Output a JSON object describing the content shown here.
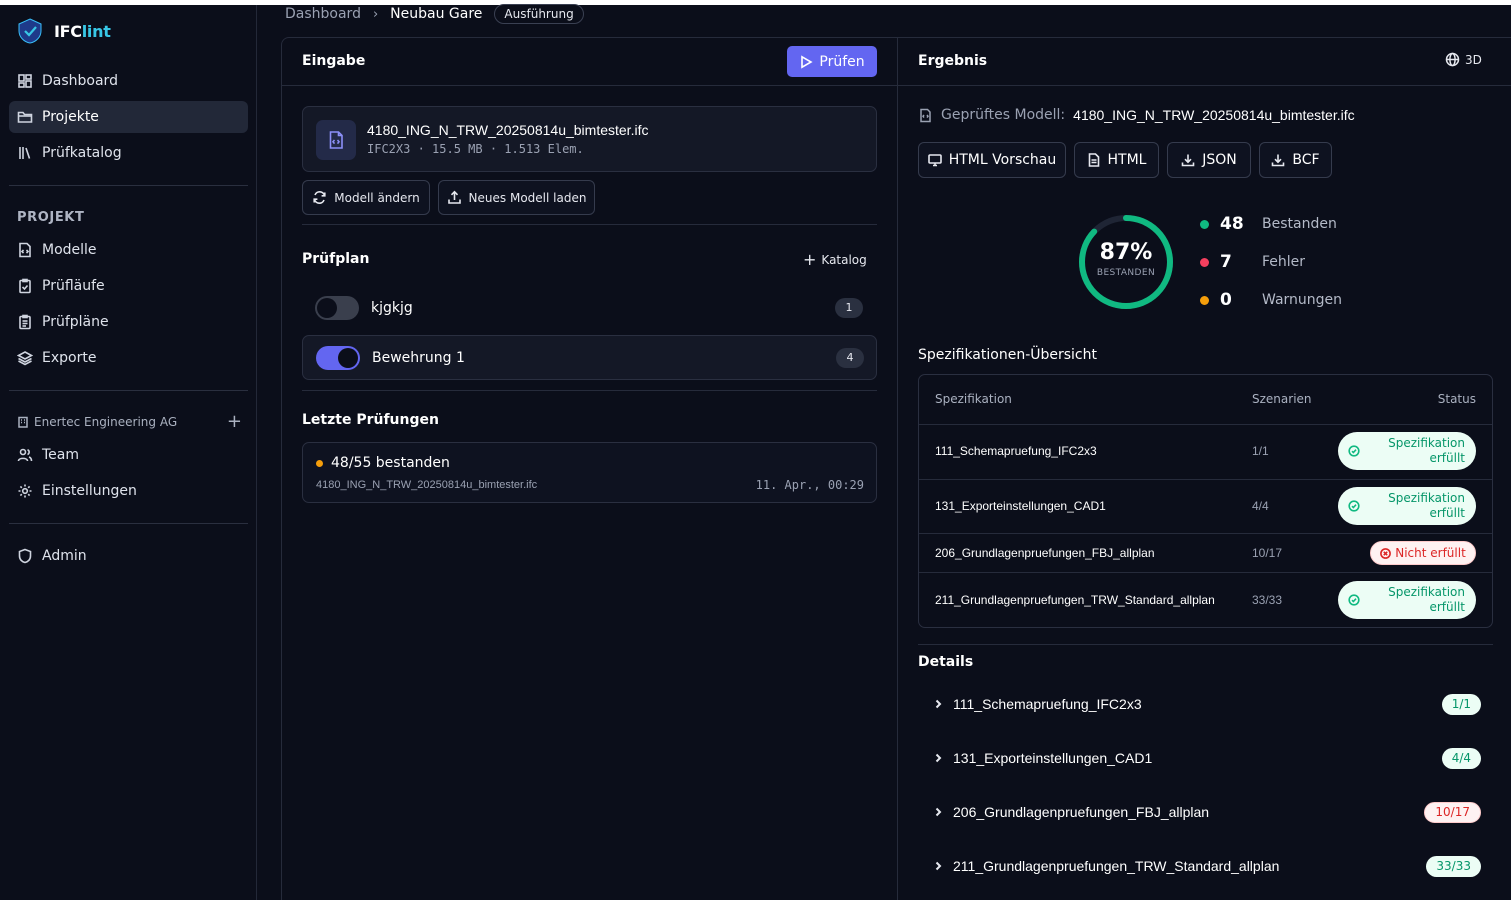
{
  "brand": {
    "name_prefix": "IFC",
    "name_suffix": "lint"
  },
  "sidebar": {
    "main_items": [
      {
        "label": "Dashboard",
        "icon": "dashboard-icon"
      },
      {
        "label": "Projekte",
        "icon": "folder-icon",
        "active": true
      },
      {
        "label": "Prüfkatalog",
        "icon": "library-icon"
      }
    ],
    "project_section_label": "PROJEKT",
    "project_items": [
      {
        "label": "Modelle",
        "icon": "file-code-icon"
      },
      {
        "label": "Prüfläufe",
        "icon": "clipboard-check-icon"
      },
      {
        "label": "Prüfpläne",
        "icon": "clipboard-list-icon"
      },
      {
        "label": "Exporte",
        "icon": "layers-icon"
      }
    ],
    "org_name": "Enertec Engineering AG",
    "org_items": [
      {
        "label": "Team",
        "icon": "users-icon"
      },
      {
        "label": "Einstellungen",
        "icon": "gear-icon"
      }
    ],
    "admin_label": "Admin"
  },
  "breadcrumb": {
    "root": "Dashboard",
    "current": "Neubau Gare",
    "badge": "Ausführung"
  },
  "input_panel": {
    "title": "Eingabe",
    "check_button": "Prüfen",
    "file": {
      "name": "4180_ING_N_TRW_20250814u_bimtester.ifc",
      "meta": "IFC2X3 · 15.5 MB · 1.513 Elem."
    },
    "change_model_button": "Modell ändern",
    "load_model_button": "Neues Modell laden",
    "plan_title": "Prüfplan",
    "catalog_link": "Katalog",
    "plans": [
      {
        "name": "kjgkjg",
        "count": "1",
        "enabled": false
      },
      {
        "name": "Bewehrung 1",
        "count": "4",
        "enabled": true
      }
    ],
    "recent_title": "Letzte Prüfungen",
    "recent": {
      "summary": "48/55 bestanden",
      "file": "4180_ING_N_TRW_20250814u_bimtester.ifc",
      "time": "11. Apr., 00:29",
      "status_color": "#f59e0b"
    }
  },
  "result_panel": {
    "title": "Ergebnis",
    "view_3d": "3D",
    "model_label": "Geprüftes Modell:",
    "model_value": "4180_ING_N_TRW_20250814u_bimtester.ifc",
    "exports": [
      "HTML Vorschau",
      "HTML",
      "JSON",
      "BCF"
    ],
    "score": {
      "percent_label": "87%",
      "percent": 87,
      "sub": "BESTANDEN"
    },
    "stats": [
      {
        "value": "48",
        "label": "Bestanden",
        "color": "#10b981"
      },
      {
        "value": "7",
        "label": "Fehler",
        "color": "#f43f5e"
      },
      {
        "value": "0",
        "label": "Warnungen",
        "color": "#f59e0b"
      }
    ],
    "spec_heading": "Spezifikationen-Übersicht",
    "spec_headers": {
      "name": "Spezifikation",
      "count": "Szenarien",
      "status": "Status"
    },
    "specs": [
      {
        "name": "111_Schemapruefung_IFC2x3",
        "count": "1/1",
        "status": "Spezifikation erfüllt",
        "ok": true
      },
      {
        "name": "131_Exporteinstellungen_CAD1",
        "count": "4/4",
        "status": "Spezifikation erfüllt",
        "ok": true
      },
      {
        "name": "206_Grundlagenpruefungen_FBJ_allplan",
        "count": "10/17",
        "status": "Nicht erfüllt",
        "ok": false
      },
      {
        "name": "211_Grundlagenpruefungen_TRW_Standard_allplan",
        "count": "33/33",
        "status": "Spezifikation erfüllt",
        "ok": true
      }
    ],
    "details_title": "Details",
    "details": [
      {
        "name": "111_Schemapruefung_IFC2x3",
        "count": "1/1",
        "ok": true
      },
      {
        "name": "131_Exporteinstellungen_CAD1",
        "count": "4/4",
        "ok": true
      },
      {
        "name": "206_Grundlagenpruefungen_FBJ_allplan",
        "count": "10/17",
        "ok": false
      },
      {
        "name": "211_Grundlagenpruefungen_TRW_Standard_allplan",
        "count": "33/33",
        "ok": true
      }
    ],
    "colors": {
      "accent": "#6366f1",
      "success": "#10b981",
      "danger": "#dc2626"
    }
  }
}
